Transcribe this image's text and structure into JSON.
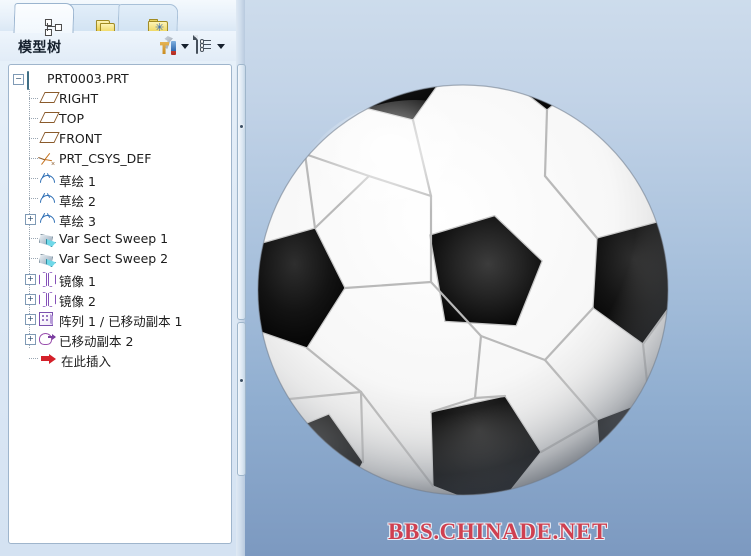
{
  "window": {
    "title": "模型树"
  },
  "tabs": [
    {
      "name": "model-tree",
      "icon": "model-tree-icon",
      "active": true
    },
    {
      "name": "layer-tree",
      "icon": "folders-icon",
      "active": false
    },
    {
      "name": "folder-browser",
      "icon": "folder-star-icon",
      "active": false
    }
  ],
  "panel_header": {
    "title": "模型树",
    "buttons": [
      {
        "name": "settings-tools-button",
        "icon": "tools-icon",
        "dropdown": true
      },
      {
        "name": "display-list-button",
        "icon": "list-icon",
        "dropdown": true
      }
    ]
  },
  "tree": {
    "nodes": [
      {
        "label": "PRT0003.PRT",
        "icon": "part-icon",
        "indent": 0,
        "expander": "-"
      },
      {
        "label": "RIGHT",
        "icon": "plane-icon",
        "indent": 1,
        "expander": ""
      },
      {
        "label": "TOP",
        "icon": "plane-icon",
        "indent": 1,
        "expander": ""
      },
      {
        "label": "FRONT",
        "icon": "plane-icon",
        "indent": 1,
        "expander": ""
      },
      {
        "label": "PRT_CSYS_DEF",
        "icon": "csys-icon",
        "indent": 1,
        "expander": ""
      },
      {
        "label": "草绘 1",
        "icon": "sketch-icon",
        "indent": 1,
        "expander": ""
      },
      {
        "label": "草绘 2",
        "icon": "sketch-icon",
        "indent": 1,
        "expander": ""
      },
      {
        "label": "草绘 3",
        "icon": "sketch-icon",
        "indent": 1,
        "expander": "+"
      },
      {
        "label": "Var Sect Sweep 1",
        "icon": "sweep-icon",
        "indent": 1,
        "expander": ""
      },
      {
        "label": "Var Sect Sweep 2",
        "icon": "sweep-icon",
        "indent": 1,
        "expander": ""
      },
      {
        "label": "镜像 1",
        "icon": "mirror-icon",
        "indent": 1,
        "expander": "+"
      },
      {
        "label": "镜像 2",
        "icon": "mirror-icon",
        "indent": 1,
        "expander": "+"
      },
      {
        "label": "阵列 1 / 已移动副本 1",
        "icon": "pattern-icon",
        "indent": 1,
        "expander": "+"
      },
      {
        "label": "已移动副本 2",
        "icon": "move-copy-icon",
        "indent": 1,
        "expander": "+"
      },
      {
        "label": "在此插入",
        "icon": "insert-here-icon",
        "indent": 1,
        "expander": ""
      }
    ]
  },
  "splitter": {
    "name": "panel-splitter",
    "handles": 2
  },
  "viewport": {
    "model": "soccer-ball",
    "background_top": "#cddcec",
    "background_bottom": "#7c99c0",
    "watermark": "BBS.CHINADE.NET",
    "watermark_color": "#cf4050"
  }
}
